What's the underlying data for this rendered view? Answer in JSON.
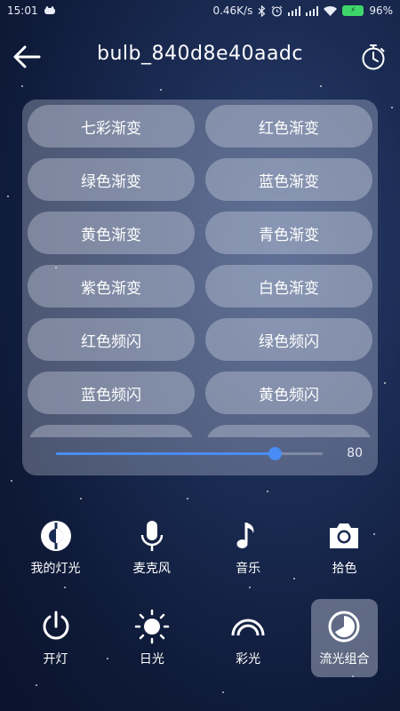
{
  "status_bar": {
    "time": "15:01",
    "network_speed": "0.46K/s",
    "battery_level": "96%",
    "icons": [
      "notification-icon",
      "bluetooth-icon",
      "alarm-icon",
      "signal-icon",
      "wifi-icon",
      "battery-icon"
    ]
  },
  "header": {
    "title": "bulb_840d8e40aadc",
    "back_icon": "arrow-left-icon",
    "timer_icon": "stopwatch-icon"
  },
  "modes": [
    {
      "label": "七彩渐变"
    },
    {
      "label": "红色渐变"
    },
    {
      "label": "绿色渐变"
    },
    {
      "label": "蓝色渐变"
    },
    {
      "label": "黄色渐变"
    },
    {
      "label": "青色渐变"
    },
    {
      "label": "紫色渐变"
    },
    {
      "label": "白色渐变"
    },
    {
      "label": "红色频闪"
    },
    {
      "label": "绿色频闪"
    },
    {
      "label": "蓝色频闪"
    },
    {
      "label": "黄色频闪"
    },
    {
      "label": ""
    },
    {
      "label": ""
    }
  ],
  "speed_slider": {
    "value": 80,
    "value_label": "80",
    "fraction": 0.82,
    "accent_color": "#4a8cf5"
  },
  "functions_row1": [
    {
      "label": "我的灯光",
      "icon": "my-light-icon"
    },
    {
      "label": "麦克风",
      "icon": "microphone-icon"
    },
    {
      "label": "音乐",
      "icon": "music-note-icon"
    },
    {
      "label": "拾色",
      "icon": "camera-icon"
    }
  ],
  "functions_row2": [
    {
      "label": "开灯",
      "icon": "power-icon"
    },
    {
      "label": "日光",
      "icon": "sun-icon"
    },
    {
      "label": "彩光",
      "icon": "rainbow-icon"
    },
    {
      "label": "流光组合",
      "icon": "flow-combo-icon",
      "active": true
    }
  ]
}
